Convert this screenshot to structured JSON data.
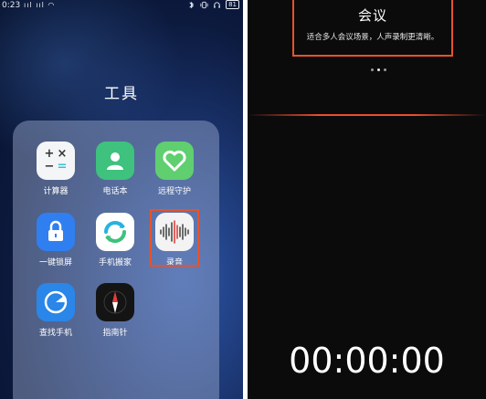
{
  "left_screen": {
    "status_bar": {
      "time": "0:23",
      "signals": "ııl ııl ◠",
      "battery": "81"
    },
    "folder_title": "工具",
    "apps": [
      {
        "label": "计算器",
        "icon": "calculator-icon"
      },
      {
        "label": "电话本",
        "icon": "contacts-icon"
      },
      {
        "label": "远程守护",
        "icon": "heart-shield-icon"
      },
      {
        "label": "一键锁屏",
        "icon": "lock-icon"
      },
      {
        "label": "手机搬家",
        "icon": "phone-clone-icon"
      },
      {
        "label": "录音",
        "icon": "sound-wave-icon"
      },
      {
        "label": "查找手机",
        "icon": "find-phone-icon"
      },
      {
        "label": "指南针",
        "icon": "compass-icon"
      }
    ],
    "calculator_glyphs": [
      "+",
      "×",
      "−",
      "="
    ]
  },
  "right_screen": {
    "mode_title": "会议",
    "mode_description": "适合多人会议场景，人声录制更清晰。",
    "timer": "00:00:00"
  },
  "colors": {
    "highlight": "#e8522b",
    "contacts_green": "#3ec27d",
    "remote_green": "#5fcf70",
    "lock_blue": "#2f7ff0",
    "find_blue": "#2a86e8",
    "recorder_red": "#e0403a"
  }
}
